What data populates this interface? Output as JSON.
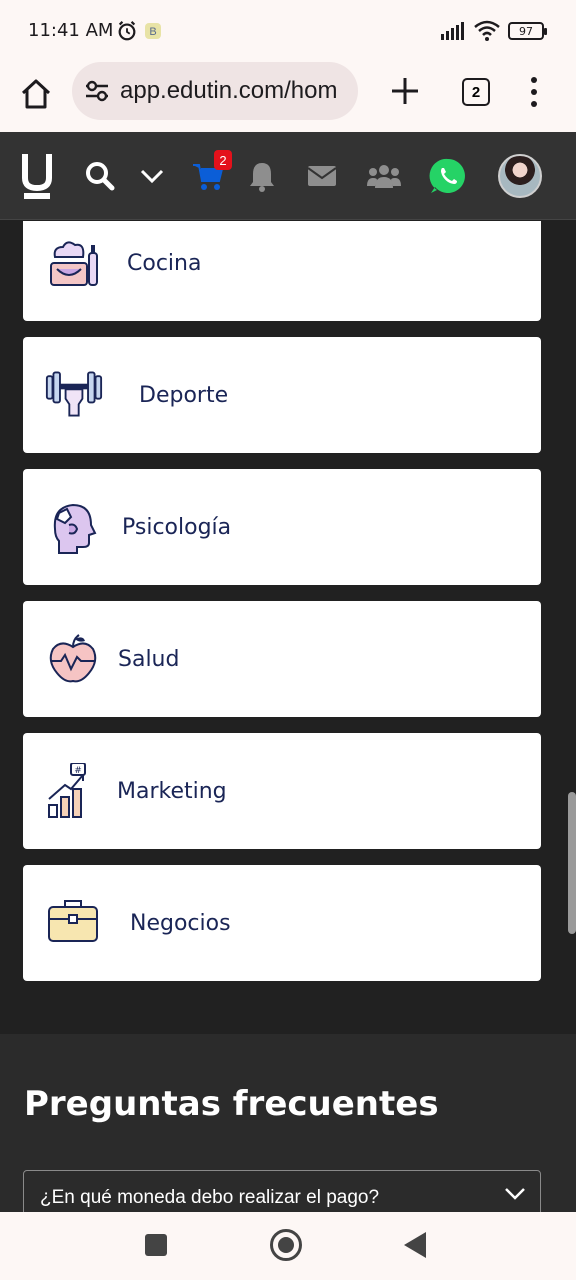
{
  "status_bar": {
    "time": "11:41 AM",
    "battery": "97",
    "icons": [
      "alarm-icon",
      "app-b-icon",
      "signal-icon",
      "wifi-icon",
      "battery-icon"
    ]
  },
  "browser": {
    "url": "app.edutin.com/hom",
    "tab_count": "2"
  },
  "site_nav": {
    "logo": "U",
    "cart_badge": "2",
    "icons": [
      "search-icon",
      "chevron-down-icon",
      "cart-icon",
      "bell-icon",
      "mail-icon",
      "community-icon",
      "whatsapp-icon",
      "avatar"
    ]
  },
  "categories": [
    {
      "label": "Cocina",
      "icon": "cooking-icon"
    },
    {
      "label": "Deporte",
      "icon": "dumbbell-icon"
    },
    {
      "label": "Psicología",
      "icon": "psychology-head-icon"
    },
    {
      "label": "Salud",
      "icon": "health-apple-icon"
    },
    {
      "label": "Marketing",
      "icon": "marketing-chart-icon"
    },
    {
      "label": "Negocios",
      "icon": "briefcase-icon"
    }
  ],
  "faq": {
    "title": "Preguntas frecuentes",
    "items": [
      {
        "question": "¿En qué moneda debo realizar el pago?"
      }
    ]
  },
  "colors": {
    "nav_bg": "#333333",
    "content_bg": "#212121",
    "card_text": "#1a2556",
    "cart_blue": "#0b5ed7",
    "badge_red": "#e4111b",
    "whatsapp_green": "#25d366"
  }
}
